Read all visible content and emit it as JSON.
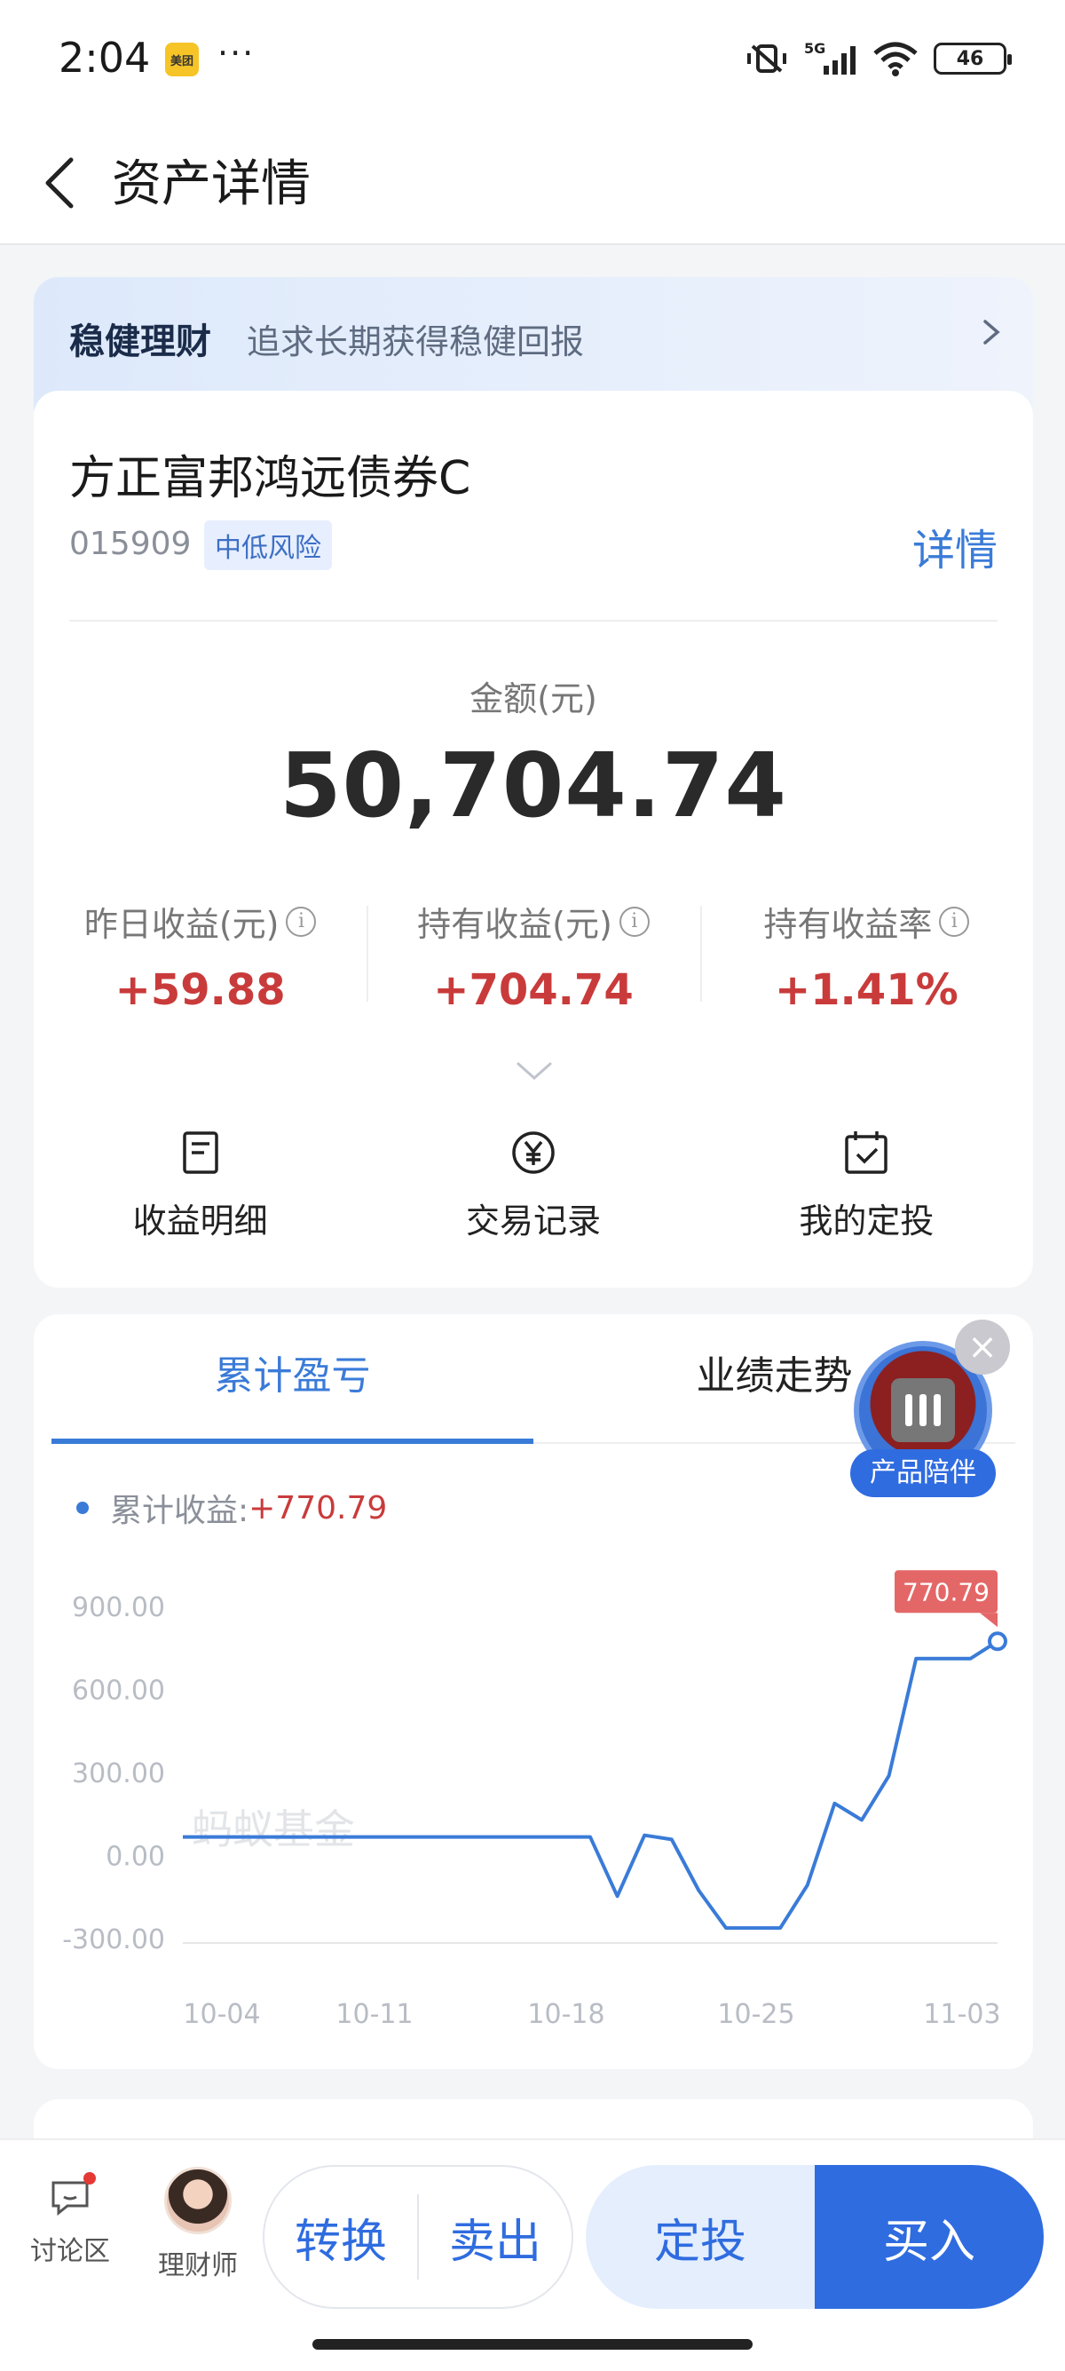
{
  "status_bar": {
    "time": "2:04",
    "app_badge": "美团",
    "more": "···",
    "network": "5G",
    "battery": "46"
  },
  "header": {
    "title": "资产详情"
  },
  "banner": {
    "strong": "稳健理财",
    "sub": "追求长期获得稳健回报"
  },
  "fund": {
    "name": "方正富邦鸿远债券C",
    "code": "015909",
    "risk": "中低风险",
    "detail_link": "详情"
  },
  "amount": {
    "label": "金额(元)",
    "value": "50,704.74"
  },
  "stats": [
    {
      "label": "昨日收益(元)",
      "value": "+59.88"
    },
    {
      "label": "持有收益(元)",
      "value": "+704.74"
    },
    {
      "label": "持有收益率",
      "value": "+1.41%"
    }
  ],
  "actions": [
    {
      "label": "收益明细",
      "icon": "document-icon"
    },
    {
      "label": "交易记录",
      "icon": "yen-circle-icon"
    },
    {
      "label": "我的定投",
      "icon": "calendar-check-icon"
    }
  ],
  "chart_tabs": [
    {
      "label": "累计盈亏"
    },
    {
      "label": "业绩走势"
    }
  ],
  "legend": {
    "label": "累计收益:",
    "value": "+770.79"
  },
  "floating": {
    "label": "产品陪伴",
    "close": "×"
  },
  "chart_data": {
    "type": "line",
    "x_tick_labels": [
      "10-04",
      "10-11",
      "10-18",
      "10-25",
      "11-03"
    ],
    "y_tick_labels": [
      "900.00",
      "600.00",
      "300.00",
      "0.00",
      "-300.00"
    ],
    "ylim": [
      -300,
      900
    ],
    "watermark": "蚂蚁基金",
    "last_value_label": "770.79",
    "series": [
      {
        "color": "#3a7bd8",
        "points": [
          {
            "x": 0,
            "y": 64
          },
          {
            "x": 1,
            "y": 64
          },
          {
            "x": 2,
            "y": 64
          },
          {
            "x": 3,
            "y": 64
          },
          {
            "x": 4,
            "y": 64
          },
          {
            "x": 5,
            "y": 64
          },
          {
            "x": 6,
            "y": 64
          },
          {
            "x": 7,
            "y": 64
          },
          {
            "x": 8,
            "y": 64
          },
          {
            "x": 9,
            "y": 64
          },
          {
            "x": 10,
            "y": 64
          },
          {
            "x": 11,
            "y": 64
          },
          {
            "x": 12,
            "y": 64
          },
          {
            "x": 13,
            "y": 64
          },
          {
            "x": 14,
            "y": 64
          },
          {
            "x": 15,
            "y": 64
          },
          {
            "x": 16,
            "y": -150
          },
          {
            "x": 17,
            "y": 70
          },
          {
            "x": 18,
            "y": 55
          },
          {
            "x": 19,
            "y": -130
          },
          {
            "x": 20,
            "y": -265
          },
          {
            "x": 21,
            "y": -265
          },
          {
            "x": 22,
            "y": -265
          },
          {
            "x": 23,
            "y": -110
          },
          {
            "x": 24,
            "y": 185
          },
          {
            "x": 25,
            "y": 125
          },
          {
            "x": 26,
            "y": 285
          },
          {
            "x": 27,
            "y": 708
          },
          {
            "x": 28,
            "y": 708
          },
          {
            "x": 29,
            "y": 708
          },
          {
            "x": 30,
            "y": 770.79
          }
        ]
      }
    ]
  },
  "bottom_bar": {
    "discuss": "讨论区",
    "advisor": "理财师",
    "convert": "转换",
    "sell": "卖出",
    "sip": "定投",
    "buy": "买入"
  }
}
